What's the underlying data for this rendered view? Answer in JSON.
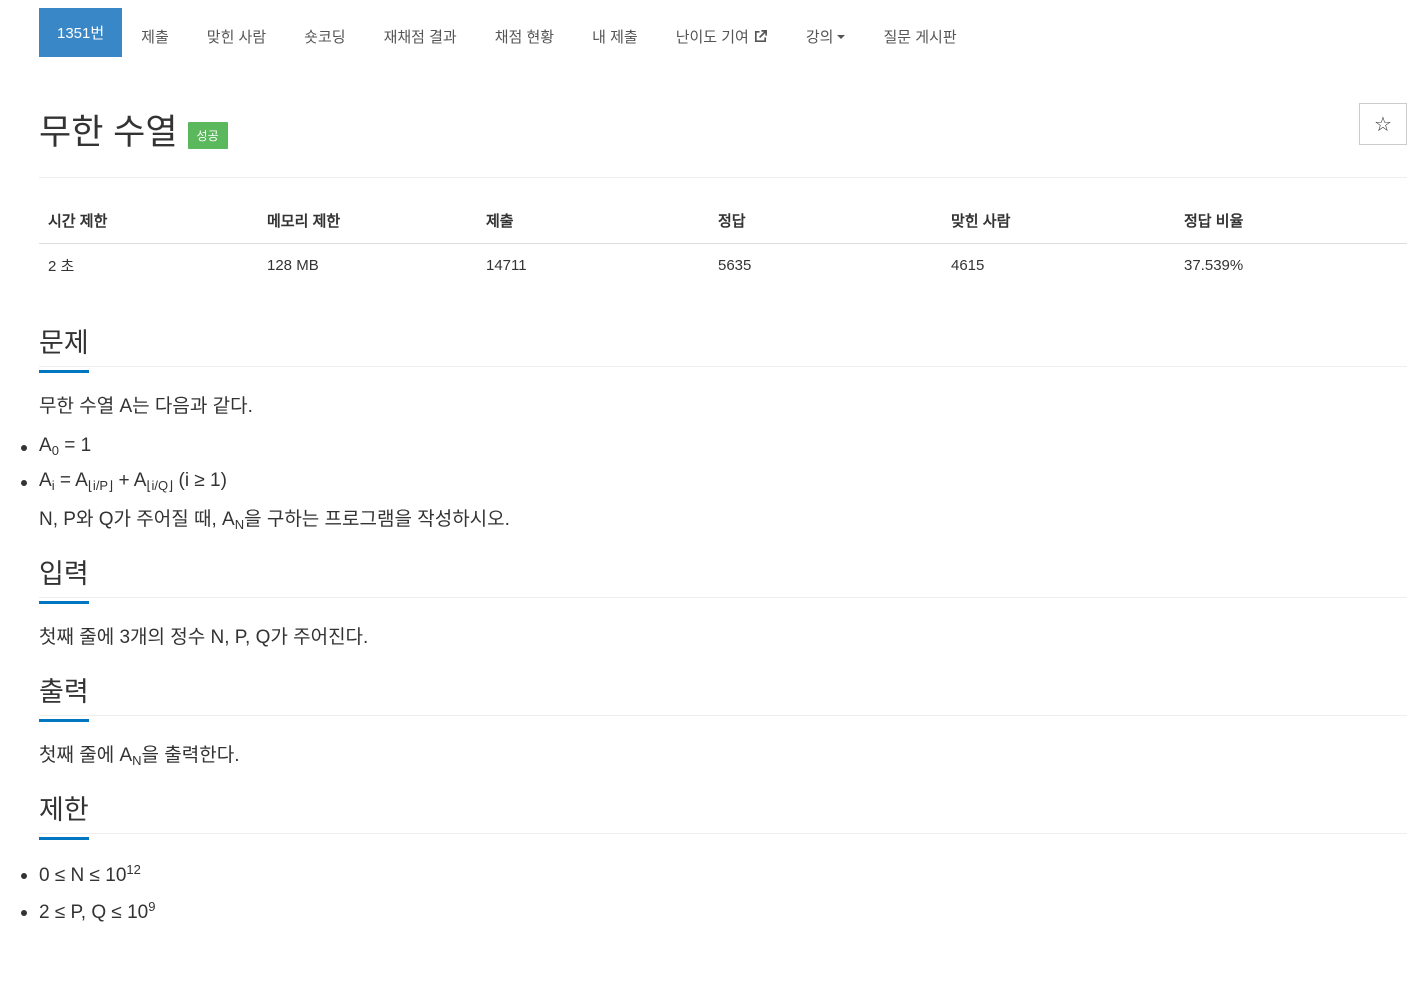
{
  "nav": {
    "tabs": [
      {
        "label": "1351번",
        "active": true
      },
      {
        "label": "제출"
      },
      {
        "label": "맞힌 사람"
      },
      {
        "label": "숏코딩"
      },
      {
        "label": "재채점 결과"
      },
      {
        "label": "채점 현황"
      },
      {
        "label": "내 제출"
      },
      {
        "label": "난이도 기여",
        "icon": "external-link-icon"
      },
      {
        "label": "강의",
        "icon": "caret-down-icon"
      },
      {
        "label": "질문 게시판"
      }
    ]
  },
  "problem": {
    "title": "무한 수열",
    "badge": "성공",
    "badge_color": "#5cb85c",
    "star_icon": "☆"
  },
  "stats": {
    "headers": [
      "시간 제한",
      "메모리 제한",
      "제출",
      "정답",
      "맞힌 사람",
      "정답 비율"
    ],
    "values": [
      "2 초",
      "128 MB",
      "14711",
      "5635",
      "4615",
      "37.539%"
    ]
  },
  "sections": {
    "problem": {
      "heading": "문제",
      "intro": "무한 수열 A는 다음과 같다.",
      "item1": {
        "base": "A",
        "sub": "0",
        "rest": " = 1"
      },
      "item2": {
        "base": "A",
        "sub": "i",
        "eq": " = A",
        "sub2": "⌊i/P⌋",
        "plus": " + A",
        "sub3": "⌊i/Q⌋",
        "rest": " (i ≥ 1)"
      },
      "outro_pre": "N, P와 Q가 주어질 때, A",
      "outro_sub": "N",
      "outro_post": "을 구하는 프로그램을 작성하시오."
    },
    "input": {
      "heading": "입력",
      "text": "첫째 줄에 3개의 정수 N, P, Q가 주어진다."
    },
    "output": {
      "heading": "출력",
      "pre": "첫째 줄에 A",
      "sub": "N",
      "post": "을 출력한다."
    },
    "limit": {
      "heading": "제한",
      "item1": {
        "text": "0 ≤ N ≤ 10",
        "sup": "12"
      },
      "item2": {
        "text": "2 ≤ P, Q ≤ 10",
        "sup": "9"
      }
    }
  },
  "accent_color": "#3a87c8",
  "underline_color": "#0076c0"
}
